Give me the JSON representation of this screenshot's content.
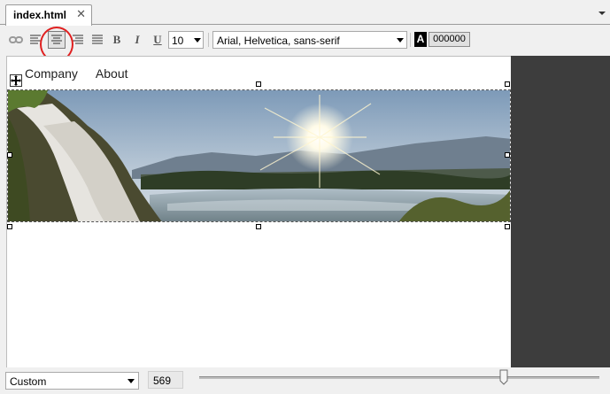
{
  "tab": {
    "title": "index.html",
    "close": "✕"
  },
  "toolbar": {
    "font_size": "10",
    "font_family": "Arial, Helvetica, sans-serif",
    "color_swatch_label": "A",
    "color_hex": "000000",
    "bold_label": "B",
    "italic_label": "I",
    "underline_label": "U",
    "highlighted_tool": "align-center-icon",
    "highlight_color": "#e02020"
  },
  "page": {
    "nav": [
      "Company",
      "About"
    ],
    "hero_image": "landscape with waterfall, river, mountains and sunburst"
  },
  "status": {
    "preset": "Custom",
    "width": "569",
    "slider_value": 569
  },
  "colors": {
    "canvas_side": "#3d3d3d",
    "chrome": "#f0f0f0"
  }
}
